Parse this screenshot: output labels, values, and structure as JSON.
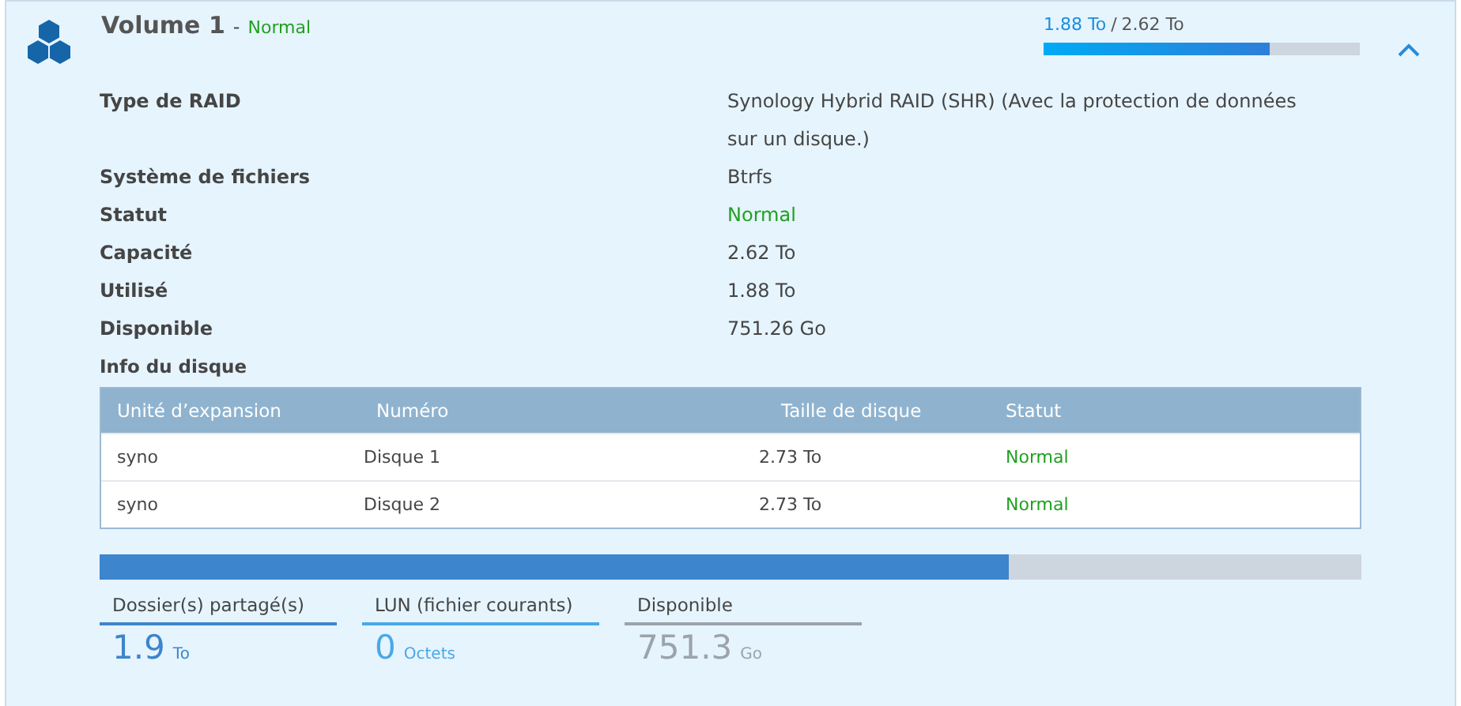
{
  "volume": {
    "title": "Volume 1",
    "separator": "-",
    "status": "Normal",
    "usage": {
      "used": "1.88 To",
      "slash": "/",
      "total": "2.62 To",
      "level": 0.717
    },
    "expanded": true
  },
  "details": [
    {
      "label": "Type de RAID",
      "value": "Synology Hybrid RAID (SHR) (Avec la protection de données sur un disque.)",
      "kind": "text"
    },
    {
      "label": "Système de fichiers",
      "value": "Btrfs",
      "kind": "text"
    },
    {
      "label": "Statut",
      "value": "Normal",
      "kind": "status"
    },
    {
      "label": "Capacité",
      "value": "2.62 To",
      "kind": "text"
    },
    {
      "label": "Utilisé",
      "value": "1.88 To",
      "kind": "text"
    },
    {
      "label": "Disponible",
      "value": "751.26 Go",
      "kind": "text"
    }
  ],
  "disk_info": {
    "title": "Info du disque",
    "columns": [
      "Unité d’expansion",
      "Numéro",
      "Taille de disque",
      "Statut"
    ],
    "rows": [
      [
        "syno",
        "Disque 1",
        "2.73 To",
        "Normal"
      ],
      [
        "syno",
        "Disque 2",
        "2.73 To",
        "Normal"
      ]
    ]
  },
  "allocation": {
    "level": 0.72,
    "segments": [
      {
        "label": "Dossier(s) partagé(s)",
        "value": "1.9",
        "unit": "To",
        "color": "#3d85cc"
      },
      {
        "label": "LUN (fichier courants)",
        "value": "0",
        "unit": "Octets",
        "color": "#4aa8e8"
      },
      {
        "label": "Disponible",
        "value": "751.3",
        "unit": "Go",
        "color": "#9ba3ab"
      }
    ]
  }
}
